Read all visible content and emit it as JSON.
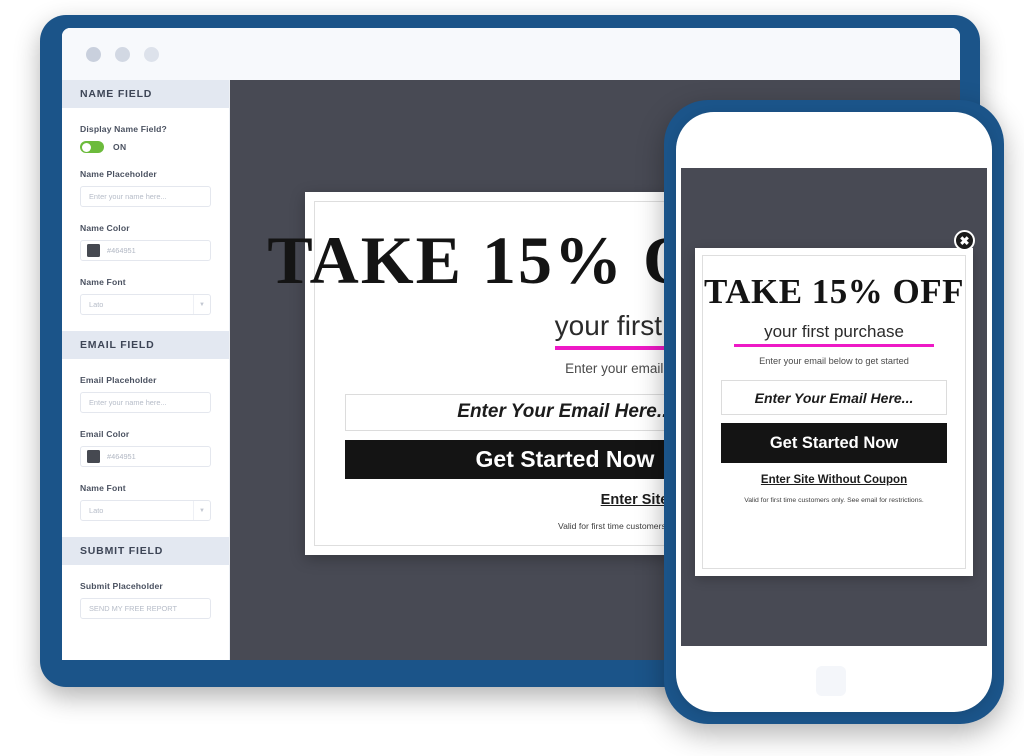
{
  "window": {
    "dots": [
      "window-dot-1",
      "window-dot-2",
      "window-dot-3"
    ]
  },
  "sidebar": {
    "sections": [
      {
        "title": "NAME FIELD",
        "fields": [
          {
            "type": "toggle",
            "label": "Display Name Field?",
            "state": "ON"
          },
          {
            "type": "text",
            "label": "Name Placeholder",
            "value": "Enter your name here..."
          },
          {
            "type": "color",
            "label": "Name Color",
            "value": "#464951",
            "swatch": "#464951"
          },
          {
            "type": "select",
            "label": "Name Font",
            "value": "Lato",
            "icon": "chevron-down-icon"
          }
        ]
      },
      {
        "title": "EMAIL FIELD",
        "fields": [
          {
            "type": "text",
            "label": "Email Placeholder",
            "value": "Enter your name here..."
          },
          {
            "type": "color",
            "label": "Email Color",
            "value": "#464951",
            "swatch": "#464951"
          },
          {
            "type": "select",
            "label": "Name Font",
            "value": "Lato",
            "icon": "chevron-down-icon"
          }
        ]
      },
      {
        "title": "SUBMIT FIELD",
        "fields": [
          {
            "type": "text",
            "label": "Submit Placeholder",
            "value": "SEND MY FREE REPORT"
          }
        ]
      }
    ]
  },
  "popup": {
    "headline_prefix": "TAKE ",
    "headline_percent": "15%",
    "headline_suffix": " OFF",
    "headline_full": "TAKE 15% OFF",
    "subline": "your first purchase",
    "note": "Enter your email below to get started",
    "email_placeholder": "Enter Your Email Here...",
    "cta_label": "Get Started Now",
    "secondary_link": "Enter Site Without Coupon",
    "fineprint": "Valid for first time customers only. See email for restrictions.",
    "close_icon": "✖",
    "accent_color": "#ee19c6",
    "cta_bg": "#141414"
  },
  "theme": {
    "frame_blue": "#1b5489",
    "canvas_dark": "#484a54",
    "section_header_bg": "#e3e8f1",
    "toggle_on": "#6cbb3c"
  }
}
